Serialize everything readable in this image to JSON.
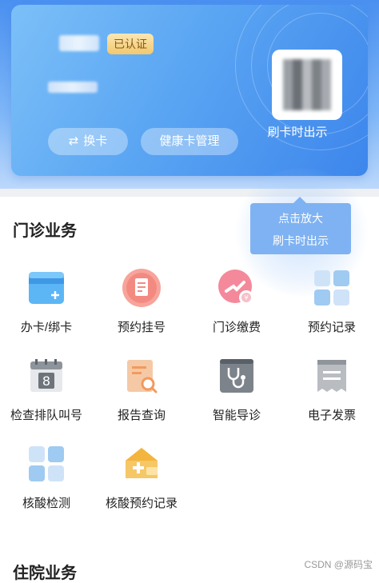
{
  "card": {
    "verified_label": "已认证",
    "switch_card_label": "换卡",
    "health_card_label": "健康卡管理",
    "qr_caption": "刷卡时出示"
  },
  "tooltip": {
    "line1": "点击放大",
    "line2": "刷卡时出示"
  },
  "outpatient": {
    "title": "门诊业务",
    "items": [
      {
        "label": "办卡/绑卡",
        "icon": "card-icon"
      },
      {
        "label": "预约挂号",
        "icon": "appointment-icon"
      },
      {
        "label": "门诊缴费",
        "icon": "payment-icon"
      },
      {
        "label": "预约记录",
        "icon": "records-grid-icon"
      },
      {
        "label": "检查排队叫号",
        "icon": "calendar-queue-icon"
      },
      {
        "label": "报告查询",
        "icon": "report-search-icon"
      },
      {
        "label": "智能导诊",
        "icon": "stethoscope-icon"
      },
      {
        "label": "电子发票",
        "icon": "invoice-icon"
      },
      {
        "label": "核酸检测",
        "icon": "nucleic-grid-icon"
      },
      {
        "label": "核酸预约记录",
        "icon": "house-plus-icon"
      }
    ]
  },
  "inpatient": {
    "title": "住院业务"
  },
  "watermark": "CSDN @源码宝"
}
